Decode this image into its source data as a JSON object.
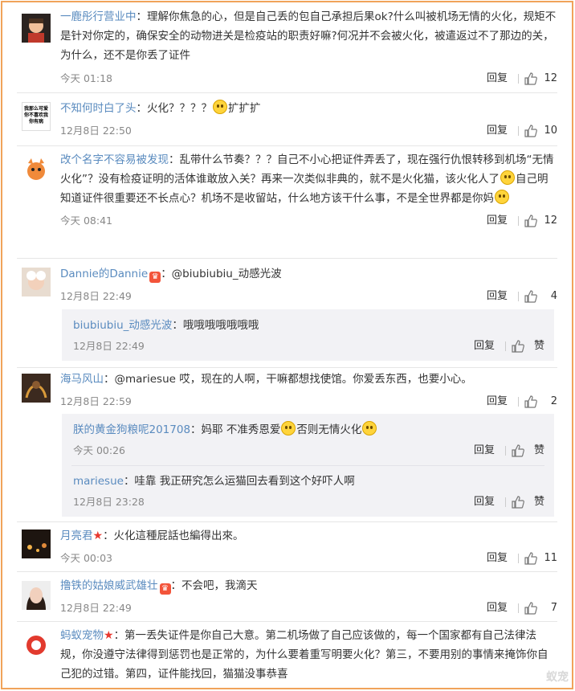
{
  "reply_label": "回复",
  "like_label_default": "赞",
  "comments": [
    {
      "user": "一鹿彤行营业中",
      "text": "：理解你焦急的心，但是自己丢的包自己承担后果ok?什么叫被机场无情的火化，规矩不是针对你定的，确保安全的动物进关是检疫站的职责好嘛?何况并不会被火化，被遣返过不了那边的关，为什么，还不是你丢了证件",
      "time": "今天 01:18",
      "likes": "12"
    },
    {
      "user": "不知何时白了头",
      "text": "：火化？？？？",
      "text_after": "扩扩扩",
      "avatar_text": "我那么可爱 你不喜欢我 你有病",
      "time": "12月8日 22:50",
      "likes": "10"
    },
    {
      "user": "改个名字不容易被发现",
      "text": "：乱带什么节奏？？？自己不小心把证件弄丢了，现在强行仇恨转移到机场“无情火化”？没有检疫证明的活体谁敢放入关？再来一次类似非典的，就不是火化猫，该火化人了",
      "text_after": "自己明知道证件很重要还不长点心？机场不是收留站，什么地方该干什么事，不是全世界都是你妈",
      "time": "今天 08:41",
      "likes": "12"
    },
    {
      "user": "Dannie的Dannie",
      "text": "：@biubiubiu_动感光波",
      "time": "12月8日 22:49",
      "likes": "4",
      "replies": [
        {
          "user": "biubiubiu_动感光波",
          "text": "：哦哦哦哦哦哦哦",
          "time": "12月8日 22:49",
          "likes": "赞"
        }
      ]
    },
    {
      "user": "海马风山",
      "text": "：@mariesue 哎，现在的人啊，干嘛都想找使馆。你爱丢东西，也要小心。",
      "time": "12月8日 22:59",
      "likes": "2",
      "replies": [
        {
          "user": "朕的黄金狗粮呢201708",
          "text": "：妈耶 不准秀恩爱",
          "text_after": "否则无情火化",
          "time": "今天 00:26",
          "likes": "赞"
        },
        {
          "user": "mariesue",
          "text": "：哇靠 我正研究怎么运猫回去看到这个好吓人啊",
          "time": "12月8日 23:28",
          "likes": "赞"
        }
      ]
    },
    {
      "user": "月亮君",
      "text": "：火化這種屁話也編得出來。",
      "time": "今天 00:03",
      "likes": "11"
    },
    {
      "user": "撸铁的姑娘威武雄壮",
      "text": "：不会吧，我滴天",
      "time": "12月8日 22:49",
      "likes": "7"
    },
    {
      "user": "蚂蚁宠物",
      "text": "：第一丢失证件是你自己大意。第二机场做了自己应该做的，每一个国家都有自己法律法规，你没遵守法律得到惩罚也是正常的，为什么要着重写明要火化？第三，不要用别的事情来掩饰你自己犯的过错。第四，证件能找回，猫猫没事恭喜",
      "time": "",
      "likes": ""
    }
  ],
  "watermark": "蚁宠"
}
